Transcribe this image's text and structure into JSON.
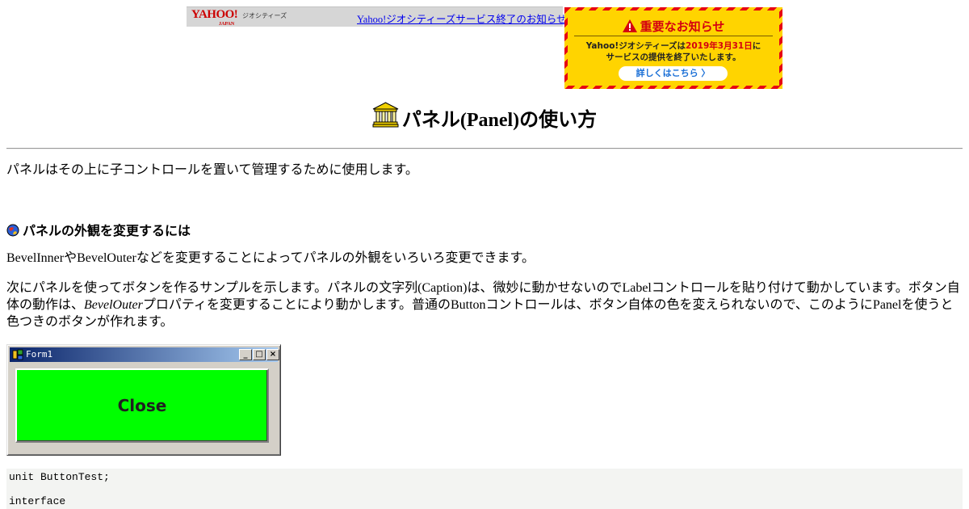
{
  "yahoo_bar": {
    "logo_text": "YAHOO!",
    "logo_sub": "JAPAN",
    "service_label": "ジオシティーズ",
    "notice_link": "Yahoo!ジオシティーズサービス終了のお知らせ"
  },
  "banner": {
    "heading": "重要なお知らせ",
    "line1_prefix": "Yahoo!ジオシティーズは",
    "line1_date": "2019年3月31日",
    "line1_suffix": "に",
    "line2": "サービスの提供を終了いたします。",
    "button_label": "詳しくはこちら 〉"
  },
  "page": {
    "title": "パネル(Panel)の使い方",
    "intro": "パネルはその上に子コントロールを置いて管理するために使用します。",
    "section_heading": "パネルの外観を変更するには",
    "para1": "BevelInnerやBevelOuterなどを変更することによってパネルの外観をいろいろ変更できます。",
    "para2_part1": "次にパネルを使ってボタンを作るサンプルを示します。パネルの文字列(Caption)は、微妙に動かせないのでLabelコントロールを貼り付けて動かしています。ボタン自体の動作は、",
    "para2_em": "BevelOuter",
    "para2_part2": "プロパティを変更することにより動かします。普通のButtonコントロールは、ボタン自体の色を変えられないので、このようにPanelを使うと色つきのボタンが作れます。"
  },
  "form_window": {
    "title": "Form1",
    "minimize": "_",
    "maximize": "□",
    "close": "×",
    "panel_caption": "Close",
    "panel_color": "#00ff00"
  },
  "code": {
    "lines": [
      "unit ButtonTest;",
      "interface"
    ]
  },
  "colors": {
    "link": "#0000ee",
    "banner_red": "#e60012",
    "banner_yellow": "#ffd400",
    "titlebar_start": "#0a246a",
    "titlebar_end": "#a6caf0"
  },
  "icons": {
    "title_icon": "temple-icon",
    "section_icon": "globe-icon",
    "banner_icon": "warning-icon"
  }
}
